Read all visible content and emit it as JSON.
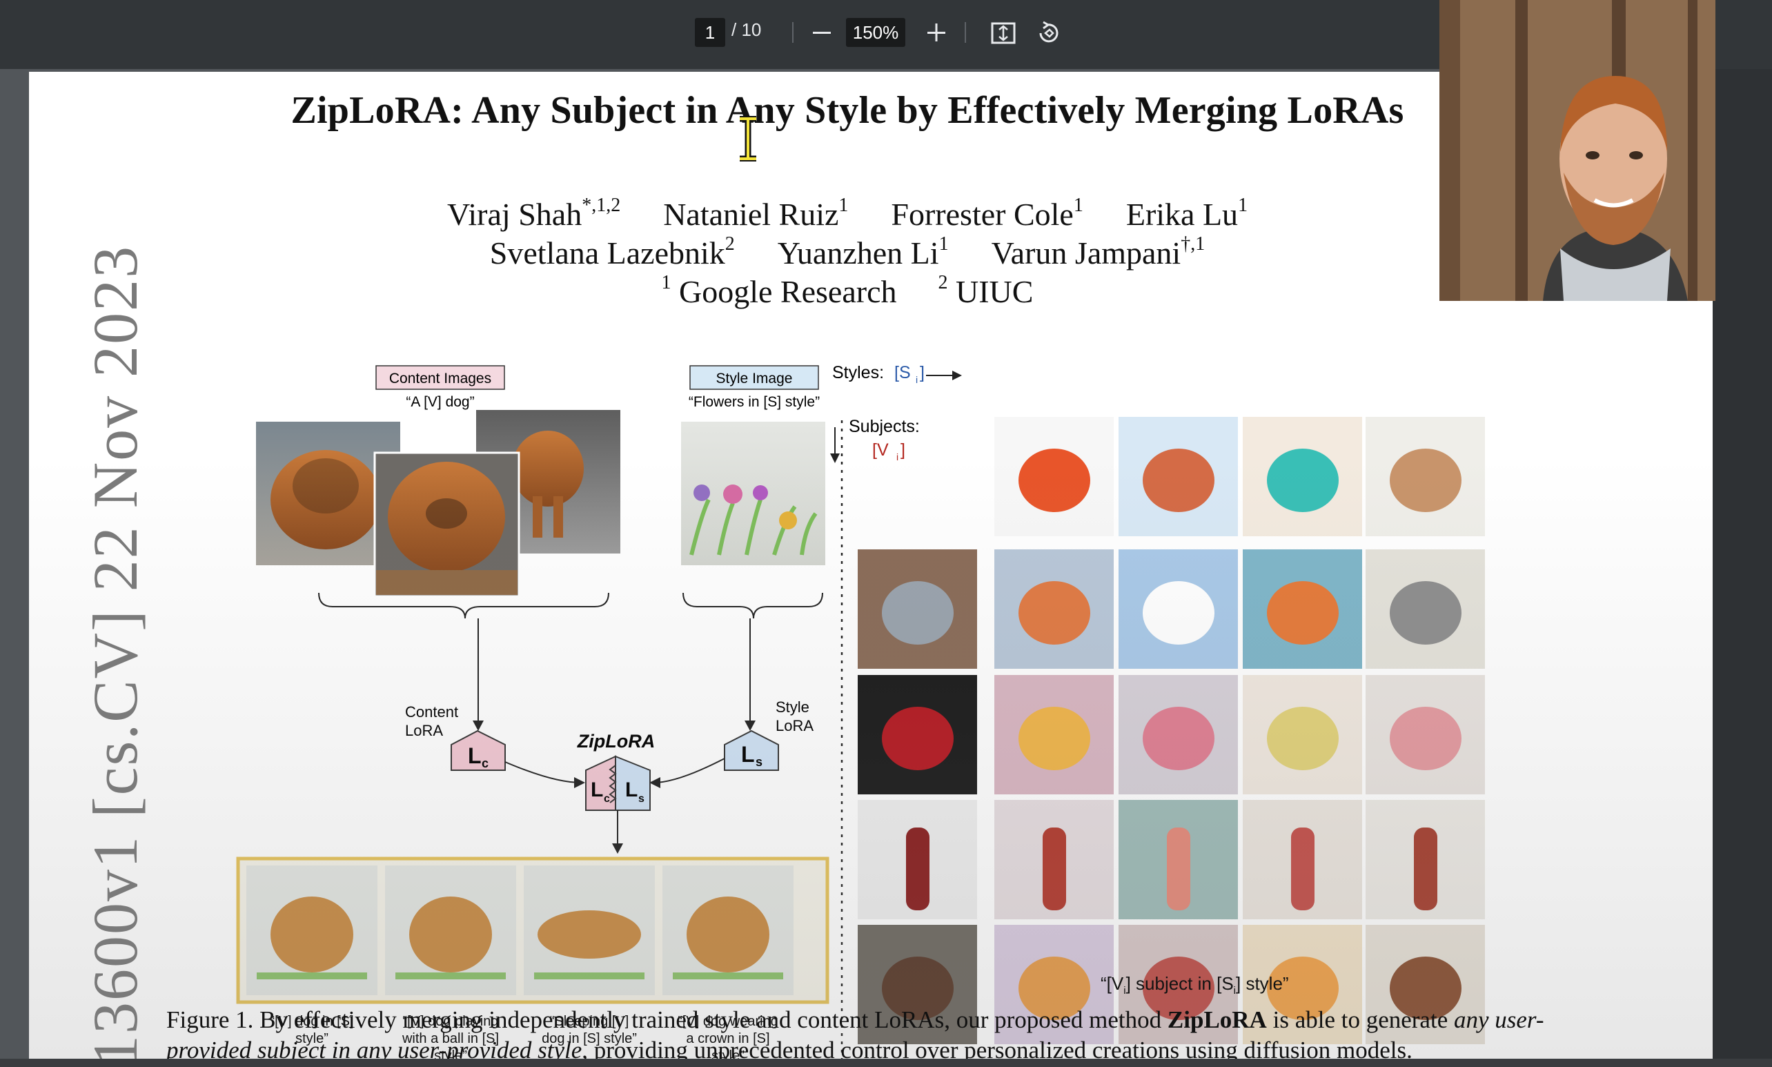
{
  "toolbar": {
    "current_page": "1",
    "page_total": "/ 10",
    "zoom_out_icon": "minus-icon",
    "zoom_level": "150%",
    "zoom_in_icon": "plus-icon",
    "fit_icon": "fit-to-page-icon",
    "rotate_icon": "rotate-icon"
  },
  "paper": {
    "title": "ZipLoRA: Any Subject in Any Style by Effectively Merging LoRAs",
    "authors_line1": [
      {
        "name": "Viraj Shah",
        "sup": "*,1,2"
      },
      {
        "name": "Nataniel Ruiz",
        "sup": "1"
      },
      {
        "name": "Forrester Cole",
        "sup": "1"
      },
      {
        "name": "Erika Lu",
        "sup": "1"
      }
    ],
    "authors_line2": [
      {
        "name": "Svetlana Lazebnik",
        "sup": "2"
      },
      {
        "name": "Yuanzhen Li",
        "sup": "1"
      },
      {
        "name": "Varun Jampani",
        "sup": "†,1"
      }
    ],
    "affiliations": [
      {
        "sup": "1",
        "name": "Google Research"
      },
      {
        "sup": "2",
        "name": "UIUC"
      }
    ],
    "arxiv_stamp": "13600v1  [cs.CV]  22 Nov 2023"
  },
  "figure": {
    "content_images_label": "Content Images",
    "content_prompt": "“A [V] dog”",
    "style_image_label": "Style Image",
    "style_prompt": "“Flowers in [S] style”",
    "content_lora_label_1": "Content",
    "content_lora_label_2": "LoRA",
    "style_lora_label_1": "Style",
    "style_lora_label_2": "LoRA",
    "lc": "L",
    "lc_sub": "c",
    "ls": "L",
    "ls_sub": "s",
    "ziplora_label": "ZipLoRA",
    "styles_label": "Styles:",
    "styles_token": "[S",
    "styles_token_sub": "i",
    "subjects_label": "Subjects:",
    "subjects_token": "[V",
    "subjects_token_sub": "i",
    "outputs": [
      {
        "l1": "“[V] dog in [S]",
        "l2": "style”",
        "l3": ""
      },
      {
        "l1": "“[V] dog playing",
        "l2": "with a ball in [S]",
        "l3": "style”"
      },
      {
        "l1": "“Sleeping [V]",
        "l2": "dog in [S] style”",
        "l3": ""
      },
      {
        "l1": "“[V] dog wearing",
        "l2": "a crown in [S]",
        "l3": "style”"
      }
    ],
    "grid_caption": "“[V",
    "grid_caption_mid": "] subject in [S",
    "grid_caption_end": "] style”",
    "grid_caption_sub": "i"
  },
  "caption": {
    "prefix": "Figure 1. By effectively merging independently trained style and content LoRAs, our proposed method ",
    "method": "ZipLoRA",
    "mid": " is able to generate ",
    "any1": "any",
    "italic_part": "user-provided subject in any user-provided style",
    "suffix": ", providing unprecedented control over personalized creations using diffusion models."
  },
  "colors": {
    "toolbar_bg": "#323639",
    "content_box": "#f4d9e0",
    "style_box": "#d6e8f5",
    "token_red": "#b3261e",
    "token_blue": "#2b5aa8",
    "output_frame": "#e6c35a"
  }
}
